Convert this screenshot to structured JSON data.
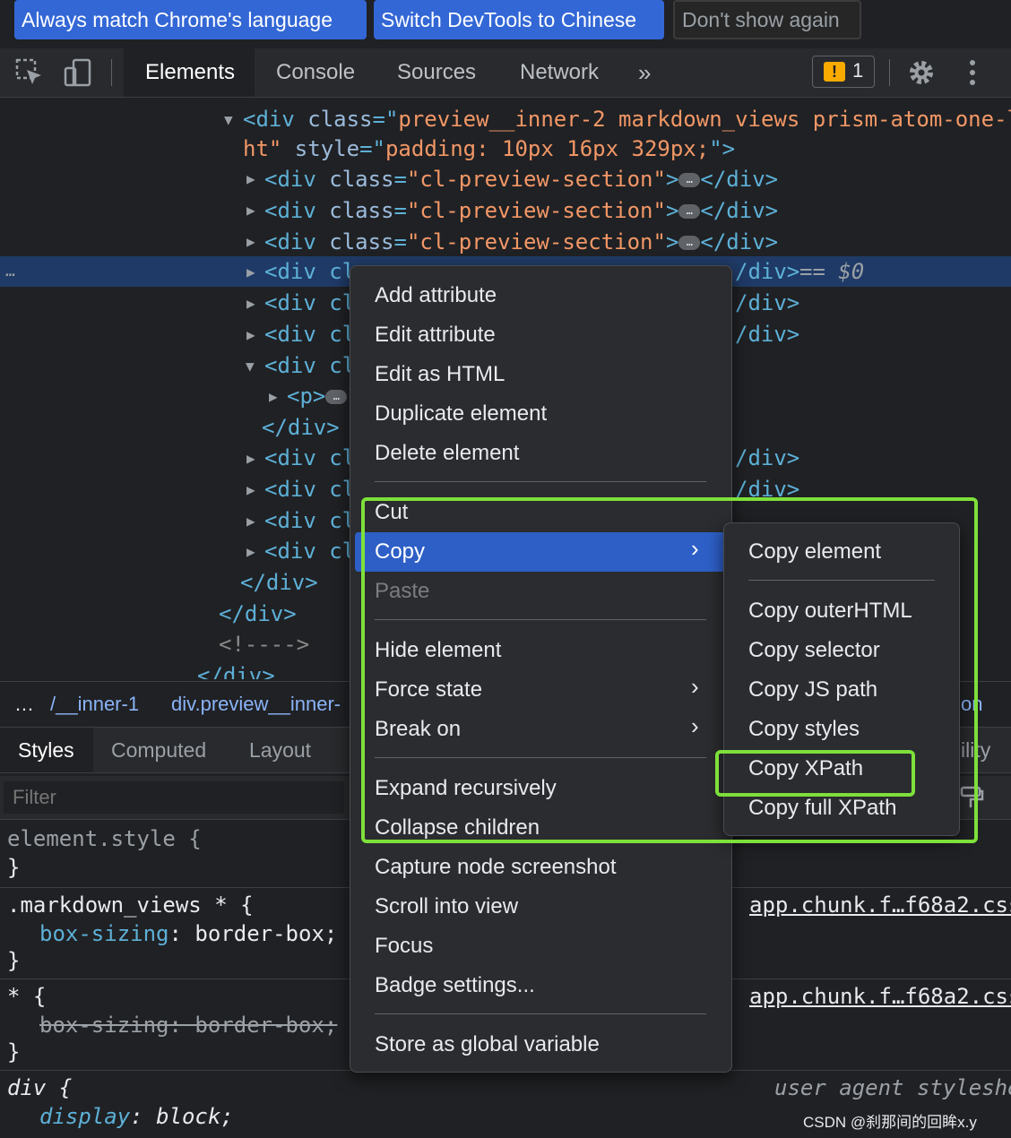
{
  "infobar": {
    "match_language": "Always match Chrome's language",
    "switch_language": "Switch DevTools to Chinese",
    "dont_show": "Don't show again"
  },
  "toolbar": {
    "tabs": [
      "Elements",
      "Console",
      "Sources",
      "Network"
    ],
    "more": "»",
    "issues_count": "1",
    "issues_flag": "!"
  },
  "dom": {
    "line1a": "<div ",
    "line1b": "class",
    "line1c": "=\"",
    "line1d": "preview__inner-2 markdown_views prism-atom-one-l",
    "line2a": "ht\"",
    "line2b": " style",
    "line2c": "=\"",
    "line2d": "padding: 10px 16px 329px;",
    "line2e": "\">",
    "section_open": "<div ",
    "section_attr": "class",
    "section_value": "\"cl-preview-section\"",
    "section_close": "</div>",
    "selected_suffix": "== $0",
    "partial_div": "<div cl",
    "partial_close": "/div>",
    "p_open": "<p>",
    "close_div": "</div>",
    "comment": "<!---->",
    "row_dots": "…",
    "ellipsis": "…"
  },
  "breadcrumbs": {
    "dots": "…",
    "item1": "/__inner-1",
    "item2": "div.preview__inner-",
    "item3": "on"
  },
  "styles": {
    "tabs": [
      "Styles",
      "Computed",
      "Layout"
    ],
    "extra_tab": "ility",
    "filter_placeholder": "Filter",
    "rule1_selector": "element.style {",
    "close": "}",
    "rule2_selector": ".markdown_views * {",
    "rule2_prop": "box-sizing",
    "rule2_val": "border-box;",
    "rule2_src": "app.chunk.f…f68a2.css",
    "rule3_selector": "* {",
    "rule3_prop": "box-sizing: border-box;",
    "rule3_src": "app.chunk.f…f68a2.css",
    "rule4_selector": "div {",
    "rule4_prop": "display",
    "rule4_val": "block;",
    "rule4_src": "user agent styleshe"
  },
  "context_menu": {
    "items": [
      "Add attribute",
      "Edit attribute",
      "Edit as HTML",
      "Duplicate element",
      "Delete element",
      "Cut",
      "Copy",
      "Paste",
      "Hide element",
      "Force state",
      "Break on",
      "Expand recursively",
      "Collapse children",
      "Capture node screenshot",
      "Scroll into view",
      "Focus",
      "Badge settings...",
      "Store as global variable"
    ]
  },
  "copy_submenu": {
    "items": [
      "Copy element",
      "Copy outerHTML",
      "Copy selector",
      "Copy JS path",
      "Copy styles",
      "Copy XPath",
      "Copy full XPath"
    ]
  },
  "watermark": "CSDN @刹那间的回眸x.y",
  "colors": {
    "highlight": "#7ee03a",
    "menu_selected": "#2e5fc7",
    "tag": "#5db0d7",
    "attr_value": "#f29766"
  }
}
